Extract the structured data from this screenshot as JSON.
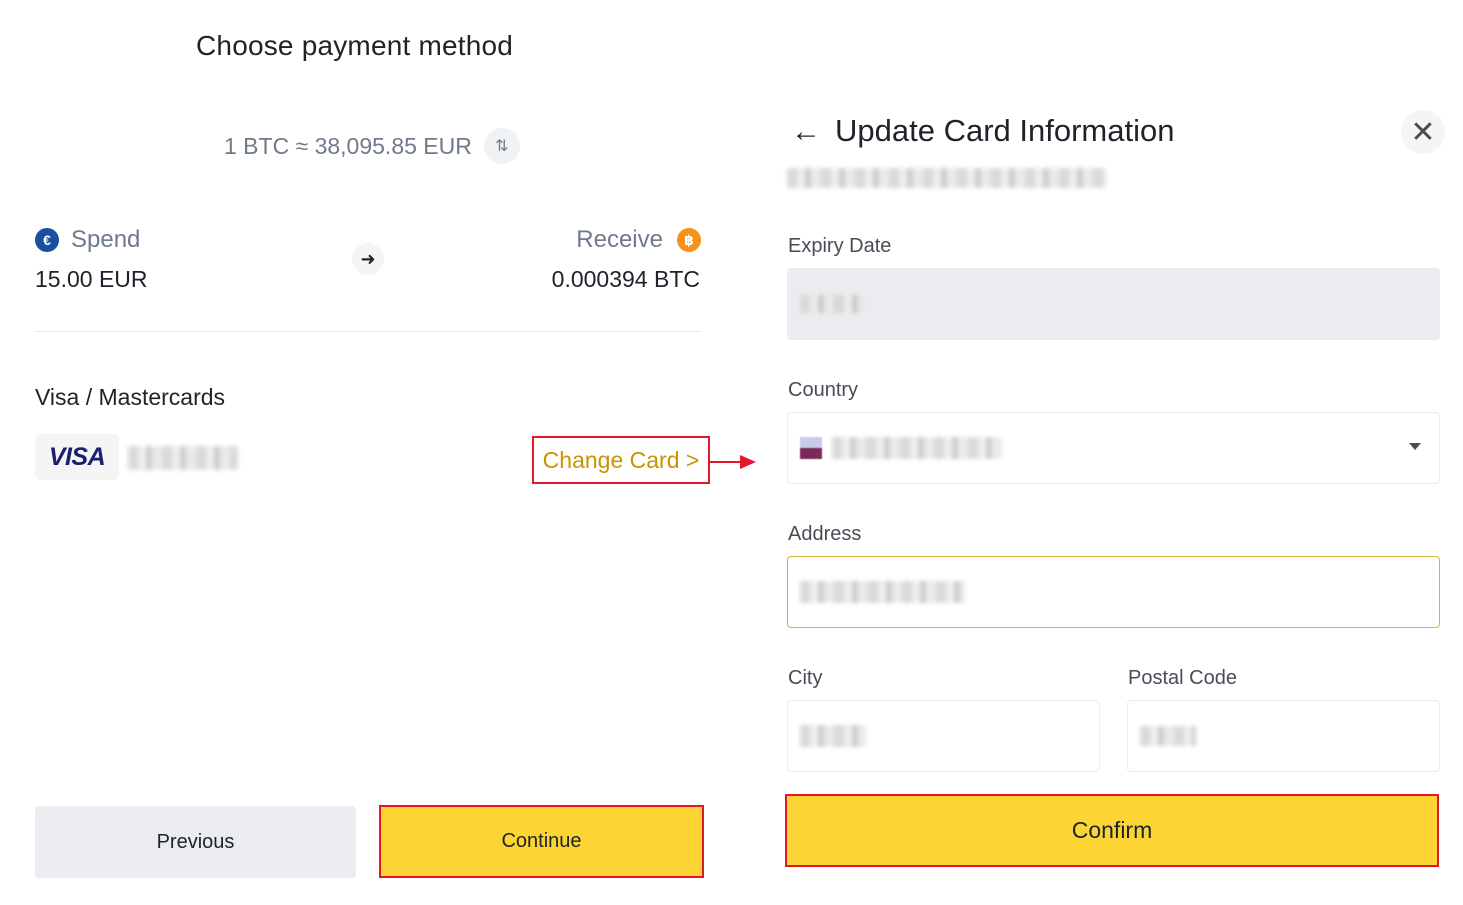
{
  "left_panel": {
    "title": "Choose payment method",
    "rate": "1 BTC ≈ 38,095.85 EUR",
    "spend": {
      "label": "Spend",
      "amount": "15.00 EUR",
      "icon": "euro-coin-icon",
      "icon_glyph": "€"
    },
    "receive": {
      "label": "Receive",
      "amount": "0.000394 BTC",
      "icon": "bitcoin-coin-icon",
      "icon_glyph": "฿"
    },
    "section_label": "Visa / Mastercards",
    "card_brand": "VISA",
    "change_card_label": "Change Card >",
    "previous_label": "Previous",
    "continue_label": "Continue"
  },
  "modal": {
    "title": "Update Card Information",
    "fields": {
      "expiry_label": "Expiry Date",
      "country_label": "Country",
      "address_label": "Address",
      "city_label": "City",
      "postal_label": "Postal Code"
    },
    "confirm_label": "Confirm"
  },
  "colors": {
    "accent_yellow": "#fcd535",
    "highlight_red": "#e0182a",
    "link_gold": "#c99400",
    "euro_blue": "#1a4fa0",
    "bitcoin_orange": "#f7931a"
  }
}
